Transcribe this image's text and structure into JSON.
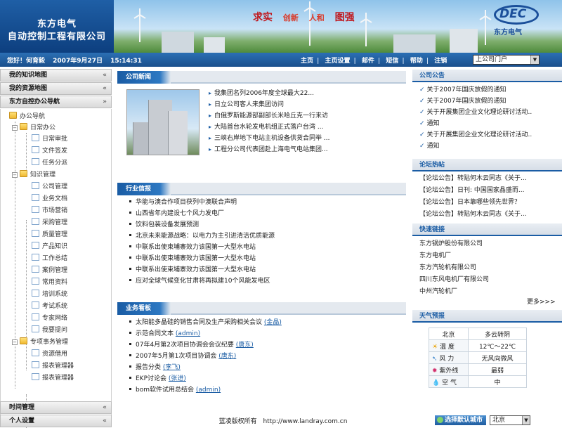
{
  "company": {
    "name_line1": "东方电气",
    "name_line2": "自动控制工程有限公司"
  },
  "slogan": [
    "求实",
    "创新",
    "人和",
    "图强"
  ],
  "brand": {
    "logo_letters": "DEC",
    "logo_sub": "东方电气"
  },
  "colors": {
    "primary_blue": "#1a5ca4",
    "nav_bar": "#2b6fb4",
    "slogan_red": "#c0161b",
    "link_blue": "#1a5ca4"
  },
  "header": {
    "greeting": "您好！何育毅",
    "date": "2007年9月27日",
    "time": "15:14:31",
    "nav_links": [
      "主页",
      "主页设置",
      "邮件",
      "短信",
      "帮助",
      "注销"
    ],
    "portal_select": "上公司门户"
  },
  "sidebar": {
    "headers": [
      {
        "label": "我的知识地图",
        "chev": "«"
      },
      {
        "label": "我的资源地图",
        "chev": "«"
      },
      {
        "label": "东方自控办公导航",
        "chev": "»"
      }
    ],
    "tree": {
      "root": "办公导航",
      "groups": [
        {
          "label": "日常办公",
          "items": [
            "日常审批",
            "文件签发",
            "任务分派"
          ]
        },
        {
          "label": "知识管理",
          "items": [
            "公司管理",
            "业务文档",
            "市场营销",
            "采购管理",
            "质量管理",
            "产品知识",
            "工作总结",
            "案例管理",
            "常用资料",
            "培训系统",
            "考试系统",
            "专家网络",
            "我要提问"
          ]
        },
        {
          "label": "专项事务管理",
          "items": [
            "资源借用",
            "报表管理器",
            "报表管理器"
          ]
        }
      ]
    },
    "bottom_headers": [
      {
        "label": "时间管理",
        "chev": "«"
      },
      {
        "label": "个人设置",
        "chev": "«"
      }
    ]
  },
  "company_news": {
    "title": "公司新闻",
    "items": [
      "我集团名列2006年度全球最大22...",
      "日立公司客人来集团访问",
      "白俄罗斯能源部副部长米哈丘克一行来访",
      "大陆首台水轮发电机组正式落户台湾 ...",
      "三峡右岸地下电站主机设备供货合同举 ...",
      "工程分公司代表团赴上海电气电站集团..."
    ]
  },
  "industry_news": {
    "title": "行业信报",
    "items": [
      "华能与澳合作项目获列中澳联合声明",
      "山西省年内建设七个风力发电厂",
      "饮料包装设备发展预测",
      "北京未来能源战略：以电力为主引进清洁优质能源",
      "中联系出使束埔寨效力该国第一大型水电站",
      "中联系出使束埔寨效力该国第一大型水电站",
      "中联系出使束埔寨效力该国第一大型水电站",
      "应对全球气候变化甘肃将再拟建10个风能发电区"
    ]
  },
  "business": {
    "title": "业务看板",
    "items": [
      {
        "text": "太阳能多晶硅的销售合同及生产采购相关会议",
        "tag": "(金晶)"
      },
      {
        "text": "示范合同文本",
        "tag": "(admin)"
      },
      {
        "text": "07年4月第2次项目协调会会议纪要",
        "tag": "(唐东)"
      },
      {
        "text": "2007年5月第1次项目协调会",
        "tag": "(唐东)"
      },
      {
        "text": "报告分类",
        "tag": "(李飞)"
      },
      {
        "text": "EKP讨论会",
        "tag": "(张进)"
      },
      {
        "text": "bom软件试用总结会",
        "tag": "(admin)"
      }
    ]
  },
  "announcements": {
    "title": "公司公告",
    "items": [
      "关于2007年国庆放假的通知",
      "关于2007年国庆放假的通知",
      "关于开展集团企业文化理论研讨活动..",
      "通知",
      "关于开展集团企业文化理论研讨活动..",
      "通知"
    ]
  },
  "forum": {
    "title": "论坛热帖",
    "items": [
      "【论坛公告】转贴何木云同志《关于...",
      "【论坛公告】日刊: 中国国家晶盛而...",
      "【论坛公告】日本靠哪些领先世界？",
      "【论坛公告】转贴何木云同志《关于..."
    ]
  },
  "quick_links": {
    "title": "快速链接",
    "items": [
      "东方锅炉股份有限公司",
      "东方电机厂",
      "东方汽轮机有限公司",
      "四川东风电机厂有限公司",
      "中州汽轮机厂"
    ],
    "more": "更多>>>"
  },
  "weather": {
    "title": "天气预报",
    "city": "北京",
    "condition": "多云转阴",
    "rows": [
      {
        "icon": "sun-icon",
        "label": "温 度",
        "value": "12℃～22℃"
      },
      {
        "icon": "wind-icon",
        "label": "风 力",
        "value": "无风向微风"
      },
      {
        "icon": "uv-icon",
        "label": "紫外线",
        "value": "最弱"
      },
      {
        "icon": "drop-icon",
        "label": "空 气",
        "value": "中"
      }
    ],
    "city_button": "选择默认城市",
    "city_select": "北京"
  },
  "footer": {
    "copyright": "蓝凌版权所有",
    "url": "http://www.landray.com.cn"
  }
}
